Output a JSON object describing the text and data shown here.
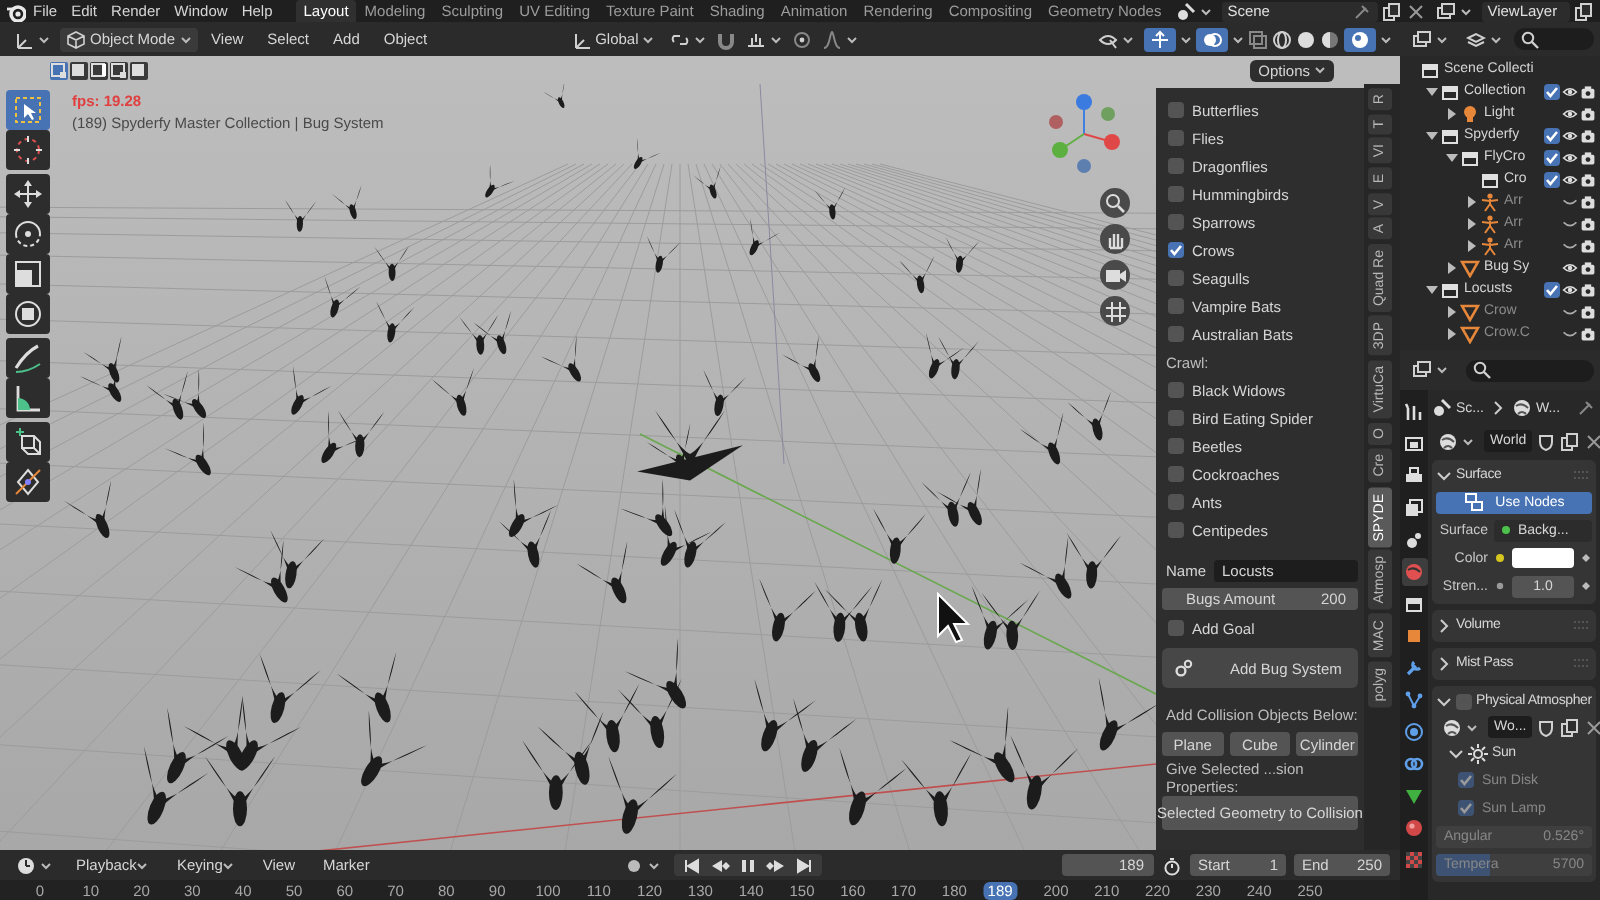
{
  "topbar": {
    "menus": [
      "File",
      "Edit",
      "Render",
      "Window",
      "Help"
    ],
    "workspaces": [
      {
        "label": "Layout",
        "selected": true
      },
      {
        "label": "Modeling",
        "selected": false
      },
      {
        "label": "Sculpting",
        "selected": false
      },
      {
        "label": "UV Editing",
        "selected": false
      },
      {
        "label": "Texture Paint",
        "selected": false
      },
      {
        "label": "Shading",
        "selected": false
      },
      {
        "label": "Animation",
        "selected": false
      },
      {
        "label": "Rendering",
        "selected": false
      },
      {
        "label": "Compositing",
        "selected": false
      },
      {
        "label": "Geometry Nodes",
        "selected": false
      }
    ],
    "scene": "Scene",
    "view_layer": "ViewLayer"
  },
  "viewport_header": {
    "mode": "Object Mode",
    "menus": [
      "View",
      "Select",
      "Add",
      "Object"
    ],
    "orientation": "Global"
  },
  "viewport": {
    "options": "Options",
    "fps": "fps: 19.28",
    "info": "(189) Spyderfy Master Collection | Bug System",
    "tools": [
      {
        "kind": "select",
        "selected": true
      },
      {
        "kind": "cursor",
        "selected": false
      },
      {
        "kind": "move",
        "selected": false
      },
      {
        "kind": "rotate",
        "selected": false
      },
      {
        "kind": "scale",
        "selected": false
      },
      {
        "kind": "transform",
        "selected": false
      },
      {
        "kind": "annotate",
        "selected": false
      },
      {
        "kind": "measure",
        "selected": false
      },
      {
        "kind": "add_cube",
        "selected": false
      },
      {
        "kind": "spin",
        "selected": false
      }
    ]
  },
  "bug_panel": {
    "fly_options": [
      {
        "label": "Butterflies",
        "checked": false
      },
      {
        "label": "Flies",
        "checked": false
      },
      {
        "label": "Dragonflies",
        "checked": false
      },
      {
        "label": "Hummingbirds",
        "checked": false
      },
      {
        "label": "Sparrows",
        "checked": false
      },
      {
        "label": "Crows",
        "checked": true
      },
      {
        "label": "Seagulls",
        "checked": false
      },
      {
        "label": "Vampire Bats",
        "checked": false
      },
      {
        "label": "Australian Bats",
        "checked": false
      }
    ],
    "crawl_heading": "Crawl:",
    "crawl_options": [
      {
        "label": "Black Widows",
        "checked": false
      },
      {
        "label": "Bird Eating Spider",
        "checked": false
      },
      {
        "label": "Beetles",
        "checked": false
      },
      {
        "label": "Cockroaches",
        "checked": false
      },
      {
        "label": "Ants",
        "checked": false
      },
      {
        "label": "Centipedes",
        "checked": false
      }
    ],
    "name_label": "Name",
    "name_value": "Locusts",
    "amount_label": "Bugs Amount",
    "amount_value": "200",
    "add_goal": {
      "label": "Add Goal",
      "checked": false
    },
    "add_button": "Add Bug System",
    "collision_heading": "Add Collision Objects Below:",
    "collision_buttons": [
      "Plane",
      "Cube",
      "Cylinder"
    ],
    "properties_heading": "Give Selected ...sion Properties:",
    "collision_button": "Selected Geometry to Collision"
  },
  "sidebar_tabs": [
    {
      "label": "R",
      "selected": false
    },
    {
      "label": "T",
      "selected": false
    },
    {
      "label": "VI",
      "selected": false
    },
    {
      "label": "E",
      "selected": false
    },
    {
      "label": "V",
      "selected": false
    },
    {
      "label": "A",
      "selected": false
    },
    {
      "label": "Quad Re",
      "selected": false
    },
    {
      "label": "3DP",
      "selected": false
    },
    {
      "label": "VirtuCa",
      "selected": false
    },
    {
      "label": "O",
      "selected": false
    },
    {
      "label": "Cre",
      "selected": false
    },
    {
      "label": "SPYDE",
      "selected": true
    },
    {
      "label": "Atmosp",
      "selected": false
    },
    {
      "label": "MAC",
      "selected": false
    },
    {
      "label": "polyg",
      "selected": false
    }
  ],
  "outliner": {
    "tree": {
      "label": "Scene Collecti",
      "kind": "scene",
      "children": [
        {
          "label": "Collection",
          "kind": "collection",
          "expanded": true,
          "checked": true,
          "visible": true,
          "children": [
            {
              "label": "Light",
              "kind": "light",
              "expanded": false,
              "visible": true
            }
          ]
        },
        {
          "label": "Spyderfy",
          "kind": "collection",
          "expanded": true,
          "checked": true,
          "visible": true,
          "children": [
            {
              "label": "FlyCro",
              "kind": "collection",
              "expanded": true,
              "checked": true,
              "visible": true,
              "children": [
                {
                  "label": "Cro",
                  "kind": "collection",
                  "checked": true,
                  "visible": true
                },
                {
                  "label": "Arr",
                  "kind": "armature",
                  "expanded": false,
                  "visible": false
                },
                {
                  "label": "Arr",
                  "kind": "armature",
                  "expanded": false,
                  "visible": false
                },
                {
                  "label": "Arr",
                  "kind": "armature",
                  "expanded": false,
                  "visible": false
                }
              ]
            },
            {
              "label": "Bug Sy",
              "kind": "mesh",
              "expanded": false,
              "visible": true
            }
          ]
        },
        {
          "label": "Locusts",
          "kind": "collection",
          "expanded": true,
          "checked": true,
          "visible": true,
          "children": [
            {
              "label": "Crow",
              "kind": "mesh",
              "expanded": false,
              "visible": false
            },
            {
              "label": "Crow.C",
              "kind": "mesh",
              "expanded": false,
              "visible": false
            }
          ]
        }
      ]
    }
  },
  "properties": {
    "tabs": [
      {
        "kind": "tool",
        "selected": false
      },
      {
        "kind": "render",
        "selected": false
      },
      {
        "kind": "output",
        "selected": false
      },
      {
        "kind": "view_layer",
        "selected": false
      },
      {
        "kind": "scene",
        "selected": false
      },
      {
        "kind": "world",
        "selected": true
      },
      {
        "kind": "collection",
        "selected": false
      },
      {
        "kind": "object",
        "selected": false
      },
      {
        "kind": "modifier",
        "selected": false
      },
      {
        "kind": "particles",
        "selected": false
      },
      {
        "kind": "physics",
        "selected": false
      },
      {
        "kind": "constraints",
        "selected": false
      },
      {
        "kind": "data",
        "selected": false
      },
      {
        "kind": "material",
        "selected": false
      },
      {
        "kind": "texture",
        "selected": false
      }
    ],
    "breadcrumb": [
      "Sc...",
      "W..."
    ],
    "world_name": "World",
    "panels": [
      {
        "kind": "surface",
        "title": "Surface",
        "expanded": true,
        "rows": [
          {
            "kind": "toggle",
            "label": "Use Nodes",
            "on": true
          },
          {
            "kind": "link",
            "label": "Surface",
            "value": "Backg..."
          },
          {
            "kind": "color",
            "label": "Color",
            "color": "#ffffff"
          },
          {
            "kind": "number",
            "label": "Stren...",
            "value": "1.0"
          }
        ]
      },
      {
        "kind": "plain",
        "title": "Volume",
        "expanded": false
      },
      {
        "kind": "plain",
        "title": "Mist Pass",
        "expanded": false
      },
      {
        "kind": "atmosphere",
        "title": "Physical Atmospher",
        "expanded": true,
        "checked": false,
        "world_name": "Wo...",
        "sub_title": "Sun",
        "sub_expanded": true,
        "rows": [
          {
            "kind": "checkbox",
            "label": "Sun Disk",
            "checked": true,
            "disabled": true
          },
          {
            "kind": "checkbox",
            "label": "Sun Lamp",
            "checked": true,
            "disabled": true
          },
          {
            "kind": "field",
            "label": "Angular",
            "value": "0.526°",
            "disabled": true
          },
          {
            "kind": "slider",
            "label": "Tempera",
            "value": "5700",
            "level": 0.35,
            "disabled": true
          }
        ]
      }
    ]
  },
  "timeline": {
    "menus": [
      {
        "label": "Playback",
        "dropdown": true
      },
      {
        "label": "Keying",
        "dropdown": true
      },
      {
        "label": "View",
        "dropdown": false
      },
      {
        "label": "Marker",
        "dropdown": false
      }
    ],
    "current_frame": "189",
    "start_label": "Start",
    "start": "1",
    "end_label": "End",
    "end": "250",
    "ruler": [
      {
        "label": "0",
        "selected": false
      },
      {
        "label": "10",
        "selected": false
      },
      {
        "label": "20",
        "selected": false
      },
      {
        "label": "30",
        "selected": false
      },
      {
        "label": "40",
        "selected": false
      },
      {
        "label": "50",
        "selected": false
      },
      {
        "label": "60",
        "selected": false
      },
      {
        "label": "70",
        "selected": false
      },
      {
        "label": "80",
        "selected": false
      },
      {
        "label": "90",
        "selected": false
      },
      {
        "label": "100",
        "selected": false
      },
      {
        "label": "110",
        "selected": false
      },
      {
        "label": "120",
        "selected": false
      },
      {
        "label": "130",
        "selected": false
      },
      {
        "label": "140",
        "selected": false
      },
      {
        "label": "150",
        "selected": false
      },
      {
        "label": "160",
        "selected": false
      },
      {
        "label": "170",
        "selected": false
      },
      {
        "label": "180",
        "selected": false
      },
      {
        "label": "189",
        "selected": true
      },
      {
        "label": "200",
        "selected": false
      },
      {
        "label": "210",
        "selected": false
      },
      {
        "label": "220",
        "selected": false
      },
      {
        "label": "230",
        "selected": false
      },
      {
        "label": "240",
        "selected": false
      },
      {
        "label": "250",
        "selected": false
      }
    ]
  }
}
